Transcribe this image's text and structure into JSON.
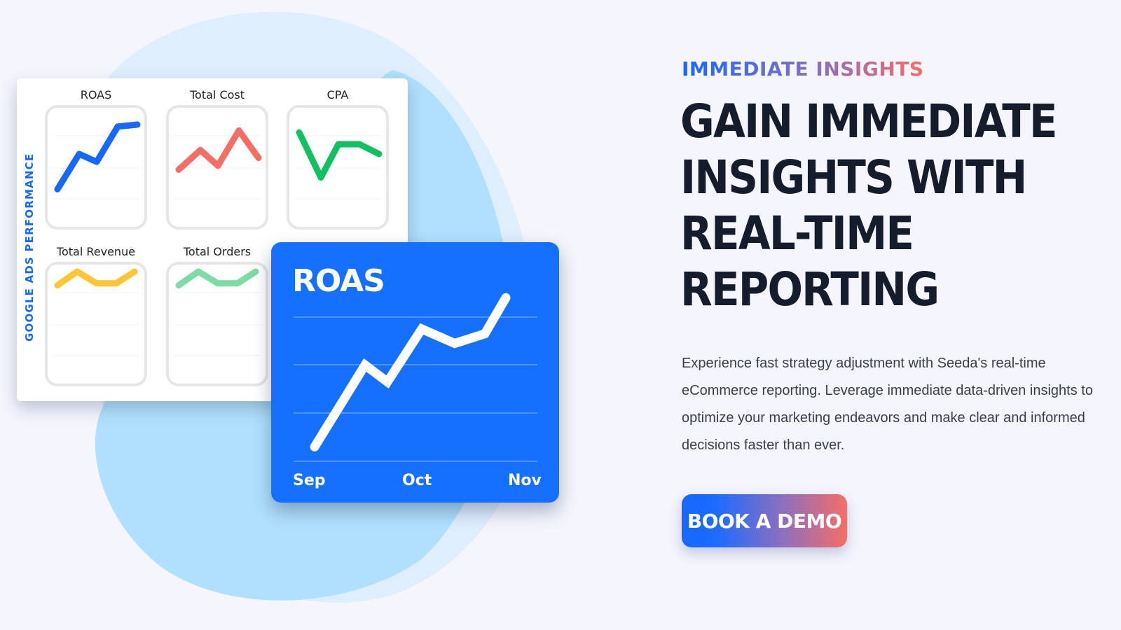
{
  "colors": {
    "background": "#f4f5fd",
    "blob_large": "#dfeefd",
    "blob_small": "#b0e0fb",
    "accent_blue": "#1668ff",
    "accent_coral": "#f56e66",
    "heading": "#151c2c"
  },
  "dashboard": {
    "side_label": "GOOGLE ADS PERFORMANCE",
    "mini_charts": [
      {
        "title": "ROAS",
        "color": "#1668ff",
        "values": [
          1.2,
          3.0,
          2.6,
          4.4,
          4.5
        ]
      },
      {
        "title": "Total Cost",
        "color": "#f56e66",
        "values": [
          2.2,
          3.2,
          2.4,
          4.2,
          2.8
        ]
      },
      {
        "title": "CPA",
        "color": "#12c061",
        "values": [
          4.1,
          1.8,
          3.5,
          3.5,
          3.0
        ]
      },
      {
        "title": "Total Revenue",
        "color": "#fcc733",
        "values": [
          4.3,
          5.0,
          4.4,
          4.4,
          5.0
        ]
      },
      {
        "title": "Total Orders",
        "color": "#7ddba4",
        "values": [
          4.3,
          5.0,
          4.4,
          4.4,
          5.0
        ]
      }
    ]
  },
  "roas_card": {
    "title": "ROAS",
    "color": "#1570ff"
  },
  "chart_data": {
    "type": "line",
    "title": "ROAS",
    "categories": [
      "Sep",
      "Oct",
      "Nov"
    ],
    "x": [
      0,
      0.35,
      0.48,
      0.72,
      0.88,
      1.0,
      1.16,
      1.32
    ],
    "series": [
      {
        "name": "ROAS",
        "values": [
          0.3,
          2.0,
          1.65,
          2.75,
          2.45,
          2.65,
          3.4
        ]
      }
    ],
    "xlabel": "",
    "ylabel": "",
    "ylim": [
      0,
      4
    ],
    "grid": true,
    "legend": "none"
  },
  "hero": {
    "eyebrow": "IMMEDIATE INSIGHTS",
    "headline_lines": [
      "GAIN IMMEDIATE",
      "INSIGHTS WITH",
      "REAL-TIME",
      "REPORTING"
    ],
    "paragraph": "Experience fast strategy adjustment with Seeda's real-time eCommerce reporting. Leverage immediate data-driven insights to optimize your marketing endeavors and make clear and informed decisions faster than ever.",
    "cta_label": "BOOK A DEMO"
  }
}
